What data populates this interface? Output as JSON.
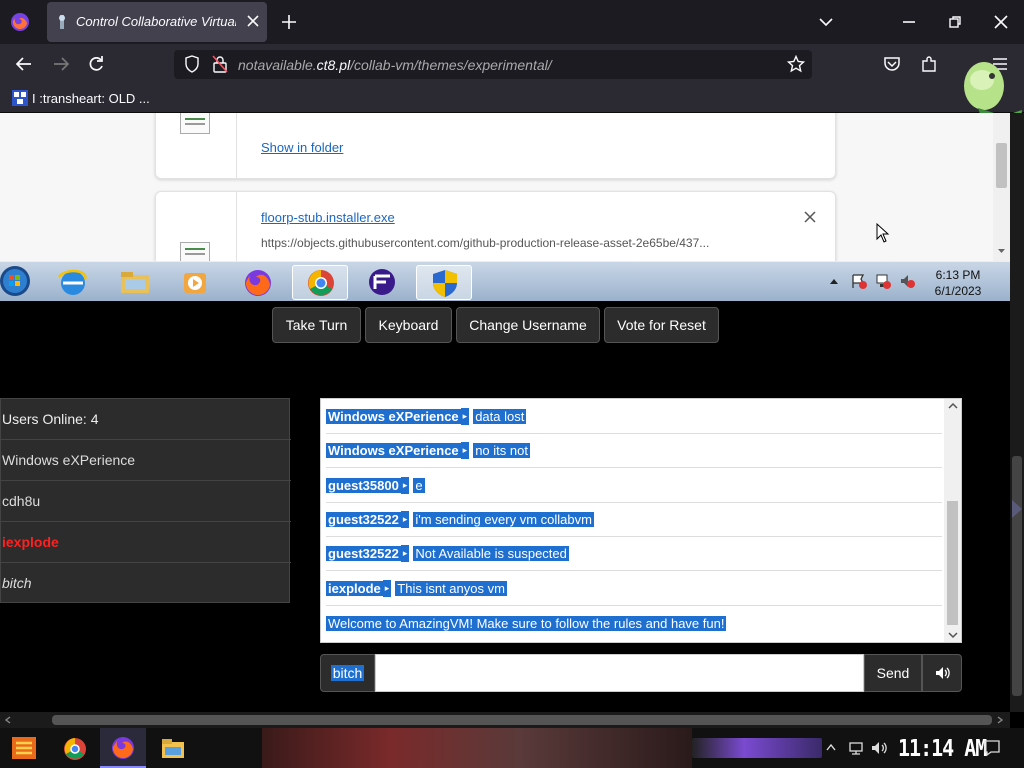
{
  "browser": {
    "tab_title": "Control Collaborative Virtual M",
    "url_prefix": "notavailable.",
    "url_domain": "ct8.pl",
    "url_path": "/collab-vm/themes/experimental/",
    "bookmark_label": "I :transheart: OLD ..."
  },
  "vm_screen": {
    "downloads": {
      "show_in_folder": "Show in folder",
      "file_name": "floorp-stub.installer.exe",
      "file_url": "https://objects.githubusercontent.com/github-production-release-asset-2e65be/437..."
    },
    "taskbar": {
      "time": "6:13 PM",
      "date": "6/1/2023"
    }
  },
  "controls": {
    "take_turn": "Take Turn",
    "keyboard": "Keyboard",
    "change_username": "Change Username",
    "vote_reset": "Vote for Reset"
  },
  "users": {
    "header": "Users Online: 4",
    "list": [
      {
        "name": "Windows eXPerience",
        "color": "#dddddd",
        "style": "normal"
      },
      {
        "name": "cdh8u",
        "color": "#dddddd",
        "style": "normal"
      },
      {
        "name": "iexplode",
        "color": "#ff2020",
        "style": "bold"
      },
      {
        "name": "bitch",
        "color": "#dddddd",
        "style": "italic"
      }
    ]
  },
  "chat": {
    "messages": [
      {
        "user": "Windows eXPerience",
        "text": "data lost"
      },
      {
        "user": "Windows eXPerience",
        "text": "no its not"
      },
      {
        "user": "guest35800",
        "text": "e"
      },
      {
        "user": "guest32522",
        "text": "i'm sending every vm collabvm"
      },
      {
        "user": "guest32522",
        "text": "Not Available is suspected"
      },
      {
        "user": "iexplode",
        "text": "This isnt anyos vm"
      }
    ],
    "welcome": "Welcome to AmazingVM! Make sure to follow the rules and have fun!",
    "username_label": "bitch",
    "input_value": "",
    "send_label": "Send"
  },
  "host_taskbar": {
    "time": "11:14 AM"
  },
  "colors": {
    "selection": "#1e6fd0",
    "browser_bg": "#1c1b22",
    "admin_user": "#ff2020"
  }
}
